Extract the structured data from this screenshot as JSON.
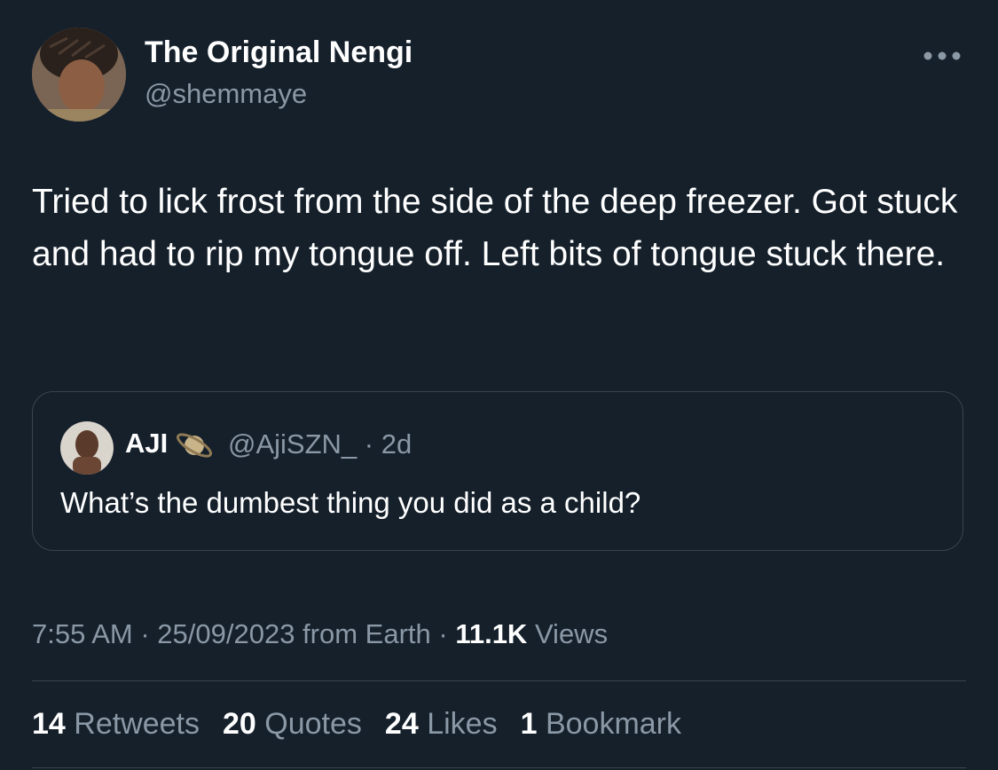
{
  "author": {
    "display_name": "The Original Nengi",
    "handle": "@shemmaye"
  },
  "tweet": {
    "text": "Tried to lick frost from the side of the deep freezer. Got stuck and had to rip my tongue off. Left bits of tongue stuck there."
  },
  "quoted_tweet": {
    "display_name": "AJI",
    "badge_icon": "ringed-planet-icon",
    "handle_time": "@AjiSZN_ · 2d",
    "text": "What’s the dumbest thing you did as a child?"
  },
  "meta": {
    "timestamp": "7:55 AM · 25/09/2023 from Earth · ",
    "views_count": "11.1K",
    "views_label": " Views"
  },
  "stats": {
    "retweets_count": "14",
    "retweets_label": " Retweets",
    "quotes_count": "20",
    "quotes_label": " Quotes",
    "likes_count": "24",
    "likes_label": " Likes",
    "bookmarks_count": "1",
    "bookmarks_label": " Bookmark"
  },
  "colors": {
    "background": "#15202b",
    "primary_text": "#ffffff",
    "secondary_text": "#8b98a5",
    "border": "#38444d"
  }
}
